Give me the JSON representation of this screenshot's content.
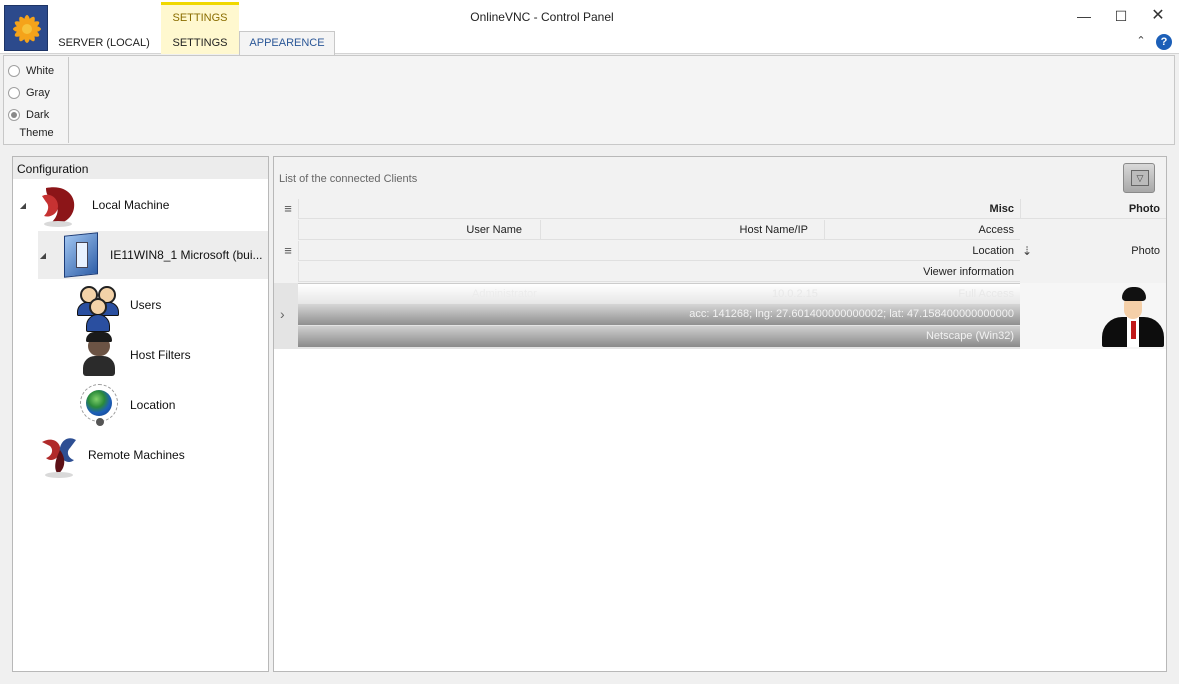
{
  "window": {
    "title": "OnlineVNC - Control Panel",
    "minimize_glyph": "—",
    "maximize_glyph": "☐",
    "close_glyph": "✕",
    "help_glyph": "?",
    "collapse_glyph": "⌃"
  },
  "ribbon": {
    "tabs": {
      "server_local": "SERVER (LOCAL)",
      "context_group": "SETTINGS",
      "settings": "SETTINGS",
      "appearence": "APPEARENCE"
    },
    "theme_group": {
      "label": "Theme",
      "options": [
        {
          "label": "White",
          "checked": false
        },
        {
          "label": "Gray",
          "checked": false
        },
        {
          "label": "Dark",
          "checked": true
        }
      ]
    }
  },
  "configuration": {
    "header": "Configuration",
    "nodes": {
      "local_machine": "Local Machine",
      "ie11win8": "IE11WIN8_1 Microsoft  (bui...",
      "users": "Users",
      "host_filters": "Host Filters",
      "location": "Location",
      "remote_machines": "Remote Machines"
    },
    "expander_glyph": "◢"
  },
  "clients": {
    "caption": "List of the connected Clients",
    "bands": {
      "misc": "Misc",
      "photo": "Photo"
    },
    "columns": {
      "user_name": "User Name",
      "host_name_ip": "Host Name/IP",
      "access": "Access",
      "location": "Location",
      "viewer_information": "Viewer information",
      "photo": "Photo"
    },
    "rows": [
      {
        "user_name": "Administrator",
        "host": "10.0.2.15",
        "access": "Full Access",
        "location": "acc: 141268; lng: 27.601400000000002; lat: 47.158400000000000",
        "viewer_information": "Netscape (Win32)"
      }
    ]
  },
  "icons": {
    "menu_glyph": "≡",
    "sort_glyph": "⇣",
    "row_expander_glyph": "›",
    "dropdown_glyph": "▽"
  }
}
